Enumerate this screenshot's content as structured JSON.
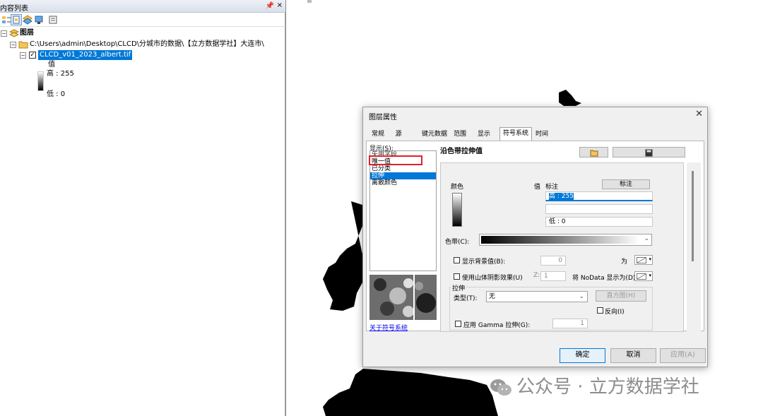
{
  "toc": {
    "title": "内容列表",
    "pin": "←",
    "close": "×",
    "layers_label": "图层",
    "path_label": "C:\\Users\\admin\\Desktop\\CLCD\\分城市的数据\\【立方数据学社】大连市\\",
    "layer_name": "CLCD_v01_2023_albert.tif",
    "legend_heading": "值",
    "legend_high": "高 : 255",
    "legend_low": "低 : 0"
  },
  "dialog": {
    "title": "图层属性",
    "close": "✕",
    "tabs": [
      "常规",
      "源",
      "键元数据",
      "范围",
      "显示",
      "符号系统",
      "时间"
    ],
    "active_tab": "符号系统",
    "show_label": "显示(S):",
    "show_list": [
      "矢用字段",
      "唯一值",
      "已分类",
      "拉伸",
      "离散颜色"
    ],
    "selected_item": "拉伸",
    "about_link": "关于符号系统",
    "panel_title": "沿色带拉伸值",
    "color_label": "颜色",
    "value_label": "值",
    "annotation_label": "标注",
    "annotation_button": "标注",
    "high_value": "高 : 255",
    "low_value": "低 : 0",
    "ramp_label": "色带(C):",
    "show_bg_label": "显示背景值(B):",
    "bg_value": "0",
    "as_label": "为",
    "hillshade_label": "使用山体阴影效果(U)",
    "z_label": "Z:",
    "z_value": "1",
    "nodata_label": "将 NoData 显示为(D)",
    "stretch_group": "拉伸",
    "type_label": "类型(T):",
    "type_value": "无",
    "histogram_btn": "直方图(H)",
    "invert_label": "反向(I)",
    "gamma_label": "应用 Gamma 拉伸(G):",
    "gamma_value": "1",
    "ok": "确定",
    "cancel": "取消",
    "apply": "应用(A)"
  },
  "watermark": "公众号 · 立方数据学社",
  "colors": {
    "selection": "#0078d7",
    "highlight_box": "#e0202a",
    "accent_button": "#0078d7"
  }
}
